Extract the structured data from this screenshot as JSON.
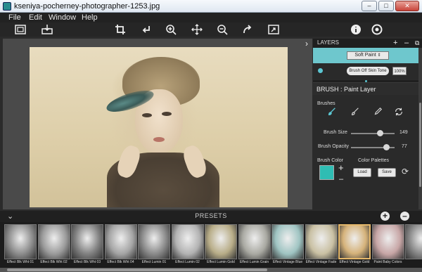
{
  "window": {
    "title": "kseniya-pocherney-photographer-1253.jpg",
    "buttons": {
      "minimize": "–",
      "maximize": "□",
      "close": "✕"
    }
  },
  "menu": [
    "File",
    "Edit",
    "Window",
    "Help"
  ],
  "toolbar": {
    "icons": [
      "fit-to-screen-icon",
      "open-image-icon",
      "crop-icon",
      "undo-icon",
      "zoom-in-icon",
      "move-icon",
      "zoom-out-icon",
      "redo-icon",
      "actual-size-icon",
      "info-icon",
      "settings-icon"
    ]
  },
  "panel_arrow": "›",
  "layers": {
    "title": "LAYERS",
    "add": "+",
    "remove": "–",
    "duplicate": "⧉",
    "blend_mode": "Soft Paint",
    "layer_name": "Brush Off Skin Tone",
    "layer_opacity": "100%"
  },
  "brush": {
    "title": "BRUSH : Paint Layer",
    "brushes_label": "Brushes",
    "size_label": "Brush Size",
    "size_value": "149",
    "size_fraction": 0.66,
    "opacity_label": "Brush Opacity",
    "opacity_value": "77",
    "opacity_fraction": 0.8,
    "color_label": "Brush Color",
    "color": "#2fbdb3",
    "palettes_label": "Color Palettes",
    "load_label": "Load",
    "save_label": "Save"
  },
  "presets": {
    "title": "PRESETS",
    "collapse": "⌄",
    "add": "+",
    "remove": "–",
    "items": [
      {
        "label": "Effect Blk Wht 01",
        "tint": "#8c8c8c"
      },
      {
        "label": "Effect Blk Wht 02",
        "tint": "#9a9a9a"
      },
      {
        "label": "Effect Blk Wht 03",
        "tint": "#808080"
      },
      {
        "label": "Effect Blk Wht 04",
        "tint": "#a4a4a4"
      },
      {
        "label": "Effect Lumin 01",
        "tint": "#8a8a8a"
      },
      {
        "label": "Effect Lumin 02",
        "tint": "#b2b2b2"
      },
      {
        "label": "Effect Lumin Gold",
        "tint": "#b8ad88"
      },
      {
        "label": "Effect Lumin Grain",
        "tint": "#a9a9a2"
      },
      {
        "label": "Effect Vintage Blue",
        "tint": "#9fc4c2"
      },
      {
        "label": "Effect Vintage Fade",
        "tint": "#c9c0a3"
      },
      {
        "label": "Effect Vintage Gold",
        "tint": "#d5b27a"
      },
      {
        "label": "Paint Baby Colors",
        "tint": "#c7a6a6"
      },
      {
        "label": "",
        "tint": "#888888"
      }
    ]
  }
}
